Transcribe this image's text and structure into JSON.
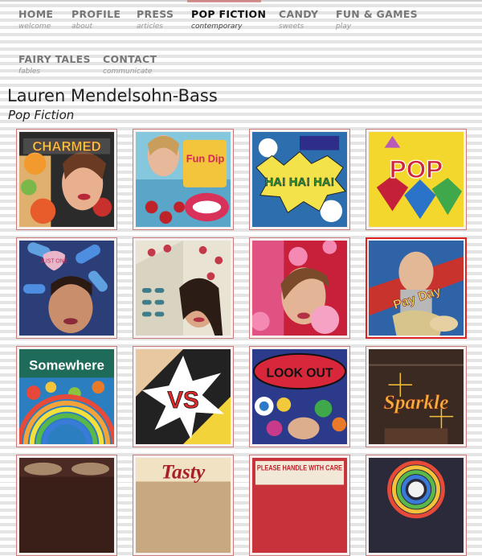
{
  "nav": [
    {
      "label": "HOME",
      "sub": "welcome",
      "active": false
    },
    {
      "label": "PROFILE",
      "sub": "about",
      "active": false
    },
    {
      "label": "PRESS",
      "sub": "articles",
      "active": false
    },
    {
      "label": "POP FICTION",
      "sub": "contemporary",
      "active": true
    },
    {
      "label": "CANDY",
      "sub": "sweets",
      "active": false
    },
    {
      "label": "FUN & GAMES",
      "sub": "play",
      "active": false
    },
    {
      "label": "FAIRY TALES",
      "sub": "fables",
      "active": false
    },
    {
      "label": "CONTACT",
      "sub": "communicate",
      "active": false
    }
  ],
  "page": {
    "artist": "Lauren Mendelsohn-Bass",
    "section": "Pop Fiction"
  },
  "gallery": [
    {
      "title": "CHARMED",
      "text": "CHARMED"
    },
    {
      "title": "Fun Dip",
      "text": "Fun Dip"
    },
    {
      "title": "HA! HA! HA!",
      "text": "HA! HA! HA!"
    },
    {
      "title": "POP",
      "text": "POP"
    },
    {
      "title": "JUST ONE",
      "text": "JUST ONE"
    },
    {
      "title": "Pills",
      "text": ""
    },
    {
      "title": "Bubblegum",
      "text": ""
    },
    {
      "title": "Pay Day",
      "text": "Pay Day"
    },
    {
      "title": "Somewhere",
      "text": "Somewhere"
    },
    {
      "title": "VS",
      "text": "VS"
    },
    {
      "title": "LOOK OUT",
      "text": "LOOK OUT"
    },
    {
      "title": "Sparkle",
      "text": "Sparkle"
    },
    {
      "title": "Bowls",
      "text": ""
    },
    {
      "title": "Tasty",
      "text": "Tasty"
    },
    {
      "title": "PLEASE HANDLE WITH CARE",
      "text": "PLEASE HANDLE WITH CARE"
    },
    {
      "title": "Rainbow",
      "text": ""
    }
  ],
  "selected_index": 7,
  "colors": {
    "accent": "#e02222",
    "tile_border": "#c87a7a",
    "nav_active": "#111111",
    "nav": "#777777"
  }
}
